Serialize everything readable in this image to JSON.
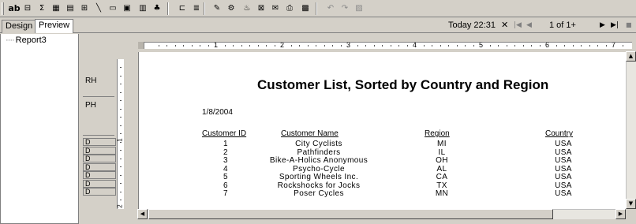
{
  "toolbar": {
    "buttons": [
      {
        "name": "text-object-button",
        "label": "ab"
      },
      {
        "name": "field-object-button",
        "label": "⊟"
      },
      {
        "name": "summary-button",
        "label": "Σ"
      },
      {
        "name": "cross-tab-button",
        "label": "▦"
      },
      {
        "name": "grid-button",
        "label": "▤"
      },
      {
        "name": "subreport-button",
        "label": "⊞"
      },
      {
        "name": "line-button",
        "label": "╲"
      },
      {
        "name": "box-button",
        "label": "▭"
      },
      {
        "name": "picture-button",
        "label": "▣"
      },
      {
        "name": "chart-button",
        "label": "▥"
      },
      {
        "name": "map-button",
        "label": "♣"
      },
      {
        "name": "group-tree-button",
        "label": "⊏"
      },
      {
        "name": "select-expert-button",
        "label": "≣"
      },
      {
        "name": "highlighting-button",
        "label": "✎"
      },
      {
        "name": "formula-button",
        "label": "⚙"
      },
      {
        "name": "database-expert-button",
        "label": "♨"
      },
      {
        "name": "template-button",
        "label": "⊠"
      },
      {
        "name": "export-button",
        "label": "✉"
      },
      {
        "name": "print-button",
        "label": "⎙"
      },
      {
        "name": "preview-button",
        "label": "▩"
      },
      {
        "name": "undo-button",
        "label": "↶"
      },
      {
        "name": "redo-button",
        "label": "↷"
      },
      {
        "name": "disabled-button",
        "label": "▨"
      }
    ]
  },
  "tabs": {
    "design": "Design",
    "preview": "Preview"
  },
  "nav": {
    "today": "Today 22:31",
    "close": "✕",
    "first": "|◀",
    "prev": "◀",
    "page": "1 of 1+",
    "next": "▶",
    "last": "▶|",
    "stop": "■"
  },
  "tree": {
    "item": "Report3"
  },
  "sections": {
    "rh": "RH",
    "ph": "PH",
    "d": "D"
  },
  "ruler": {
    "h": [
      "1",
      "2",
      "3",
      "4",
      "5",
      "6",
      "7"
    ],
    "v": [
      "1",
      "2"
    ]
  },
  "report": {
    "title": "Customer List, Sorted by Country and Region",
    "date": "1/8/2004",
    "headers": {
      "id": "Customer ID",
      "name": "Customer Name",
      "region": "Region",
      "country": "Country"
    },
    "rows": [
      {
        "id": "1",
        "name": "City Cyclists",
        "region": "MI",
        "country": "USA"
      },
      {
        "id": "2",
        "name": "Pathfinders",
        "region": "IL",
        "country": "USA"
      },
      {
        "id": "3",
        "name": "Bike-A-Holics Anonymous",
        "region": "OH",
        "country": "USA"
      },
      {
        "id": "4",
        "name": "Psycho-Cycle",
        "region": "AL",
        "country": "USA"
      },
      {
        "id": "5",
        "name": "Sporting Wheels Inc.",
        "region": "CA",
        "country": "USA"
      },
      {
        "id": "6",
        "name": "Rockshocks for Jocks",
        "region": "TX",
        "country": "USA"
      },
      {
        "id": "7",
        "name": "Poser Cycles",
        "region": "MN",
        "country": "USA"
      }
    ]
  }
}
